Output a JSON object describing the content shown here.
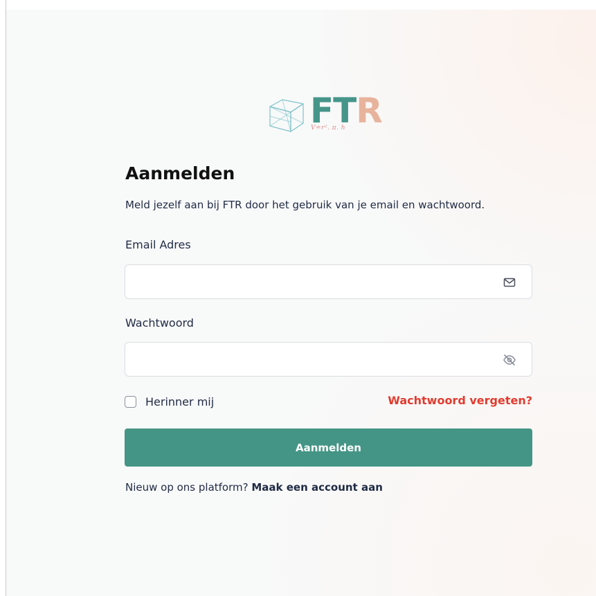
{
  "logo": {
    "letters_ft": "FT",
    "letter_r": "R",
    "formula": "V=r². π. h",
    "icon": "cube-logo-icon",
    "colors": {
      "ft": "#46958a",
      "r": "#e8b39c",
      "formula": "#e08a8a"
    }
  },
  "login": {
    "heading": "Aanmelden",
    "subtitle": "Meld jezelf aan bij FTR door het gebruik van je email en wachtwoord.",
    "email": {
      "label": "Email Adres",
      "value": "",
      "placeholder": "",
      "icon": "mail-icon"
    },
    "password": {
      "label": "Wachtwoord",
      "value": "",
      "placeholder": "",
      "icon": "eye-off-icon"
    },
    "remember_label": "Herinner mij",
    "remember_checked": false,
    "forgot_label": "Wachtwoord vergeten?",
    "submit_label": "Aanmelden",
    "signup_prompt": "Nieuw op ons platform?",
    "signup_link": "Maak een account aan"
  },
  "colors": {
    "accent": "#449585",
    "link_danger": "#e23b2e",
    "text": "#1f2a44"
  }
}
